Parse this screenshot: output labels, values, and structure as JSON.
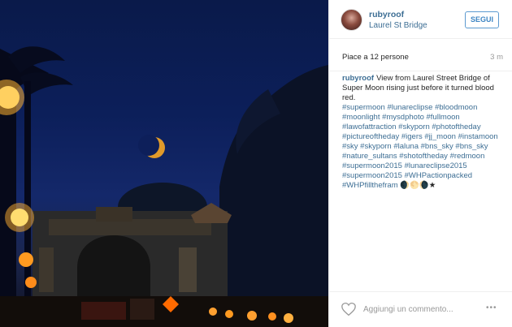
{
  "post": {
    "username": "rubyroof",
    "location": "Laurel St Bridge",
    "follow_label": "SEGUI",
    "likes": "Piace a 12 persone",
    "time": "3 m"
  },
  "caption": {
    "username": "rubyroof",
    "text": "View from Laurel Street Bridge of Super Moon rising just before it turned blood red.",
    "hashtags": "#supermoon #lunareclipse #bloodmoon #moonlight #mysdphoto #fullmoon #lawofattraction #skyporn #photoftheday #pictureoftheday #igers #jj_moon #instamoon #sky #skyporn #laluna #bns_sky #bns_sky #nature_sultans #shotoftheday #redmoon #supermoon2015 #lunareclipse2015 #supermoon2015 #WHPactionpacked #WHPfillthefram",
    "emoji": "🌒🌕🌘★"
  },
  "comment": {
    "placeholder": "Aggiungi un commento..."
  },
  "icons": {
    "like": "heart-icon",
    "more": "more-options-icon"
  },
  "colors": {
    "link": "#3d6e94",
    "follow_border": "#5c9ad0"
  }
}
